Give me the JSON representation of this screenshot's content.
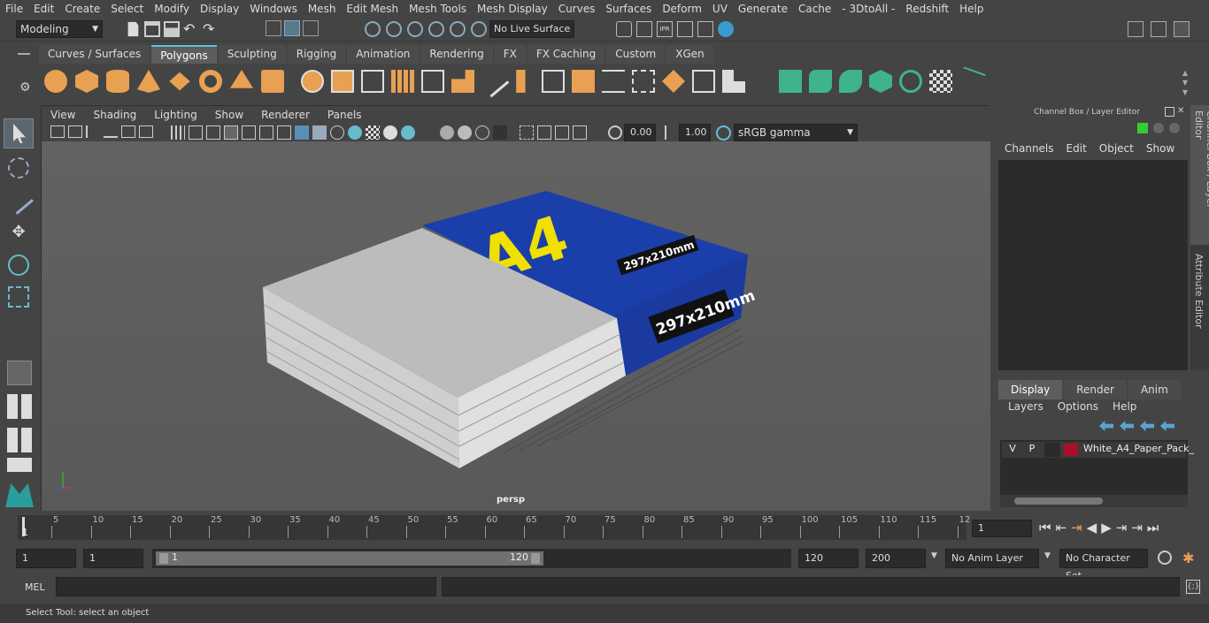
{
  "menu": [
    "File",
    "Edit",
    "Create",
    "Select",
    "Modify",
    "Display",
    "Windows",
    "Mesh",
    "Edit Mesh",
    "Mesh Tools",
    "Mesh Display",
    "Curves",
    "Surfaces",
    "Deform",
    "UV",
    "Generate",
    "Cache",
    "- 3DtoAll -",
    "Redshift",
    "Help"
  ],
  "status": {
    "mode": "Modeling",
    "live_surface": "No Live Surface"
  },
  "shelf_tabs": [
    "Curves / Surfaces",
    "Polygons",
    "Sculpting",
    "Rigging",
    "Animation",
    "Rendering",
    "FX",
    "FX Caching",
    "Custom",
    "XGen"
  ],
  "shelf_active": "Polygons",
  "viewport": {
    "menu": [
      "View",
      "Shading",
      "Lighting",
      "Show",
      "Renderer",
      "Panels"
    ],
    "exposure": "0.00",
    "gamma": "1.00",
    "color_space": "sRGB gamma",
    "camera": "persp"
  },
  "scene": {
    "top_label": "A4",
    "spine_label": "297x210mm",
    "side_label": "297x210mm"
  },
  "channel_box": {
    "title": "Channel Box / Layer Editor",
    "menu": [
      "Channels",
      "Edit",
      "Object",
      "Show"
    ]
  },
  "layer_editor": {
    "tabs": [
      "Display",
      "Render",
      "Anim"
    ],
    "menu": [
      "Layers",
      "Options",
      "Help"
    ],
    "layer": {
      "v": "V",
      "p": "P",
      "name": "White_A4_Paper_Pack_",
      "color": "#a8102a"
    }
  },
  "side_tabs": [
    "Channel Box / Layer Editor",
    "Attribute Editor"
  ],
  "timeline": {
    "ticks": [
      "5",
      "10",
      "15",
      "20",
      "25",
      "30",
      "35",
      "40",
      "45",
      "50",
      "55",
      "60",
      "65",
      "70",
      "75",
      "80",
      "85",
      "90",
      "95",
      "100",
      "105",
      "110",
      "115",
      "12"
    ],
    "first": "1",
    "current_frame": "1"
  },
  "range": {
    "start": "1",
    "start2": "1",
    "slider_start": "1",
    "slider_end": "120",
    "end": "120",
    "end2": "200",
    "anim_layer": "No Anim Layer",
    "char_set": "No Character Set"
  },
  "cmd": {
    "label": "MEL"
  },
  "help": "Select Tool: select an object",
  "colors": {
    "accent": "#5dc2d8",
    "poly_icon": "#e8a052",
    "green_icon": "#3fb38c",
    "box_blue": "#1a3faa",
    "box_yellow": "#f0e000"
  }
}
